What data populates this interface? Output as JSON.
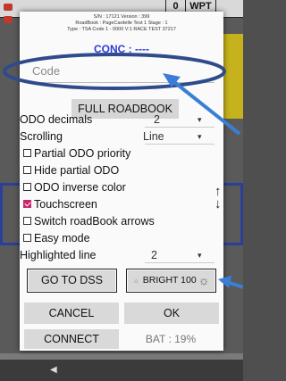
{
  "background": {
    "topbar": {
      "cells": [
        "0",
        "WPT"
      ]
    }
  },
  "dialog": {
    "header_lines": [
      "S/N : 17121 Version : 399",
      "RoadBook : PageCardelle Test 1 Stage : 1",
      "Type : TSA Code 1 - 0000 V:1 RACE TEST 37217"
    ],
    "conc_label": "CONC : ----",
    "code_placeholder": "Code",
    "full_roadbook_label": "FULL ROADBOOK",
    "settings": {
      "odo_decimals": {
        "label": "ODO decimals",
        "value": "2"
      },
      "scrolling": {
        "label": "Scrolling",
        "value": "Line"
      },
      "checkboxes": [
        {
          "label": "Partial ODO priority",
          "checked": false
        },
        {
          "label": "Hide partial ODO",
          "checked": false
        },
        {
          "label": "ODO inverse color",
          "checked": false
        },
        {
          "label": "Touchscreen",
          "checked": true
        },
        {
          "label": "Switch roadBook arrows",
          "checked": false
        },
        {
          "label": "Easy mode",
          "checked": false
        }
      ],
      "highlighted_line": {
        "label": "Highlighted line",
        "value": "2"
      }
    },
    "buttons": {
      "go_to_dss": "GO TO DSS",
      "bright": "BRIGHT 100",
      "cancel": "CANCEL",
      "ok": "OK",
      "connect": "CONNECT"
    },
    "battery": "BAT : 19%"
  },
  "colors": {
    "accent_blue": "#2b3bd6",
    "annotation_blue": "#2f4b8c",
    "annotation_arrow": "#3a7fd5",
    "checkbox_checked": "#c8266a"
  }
}
